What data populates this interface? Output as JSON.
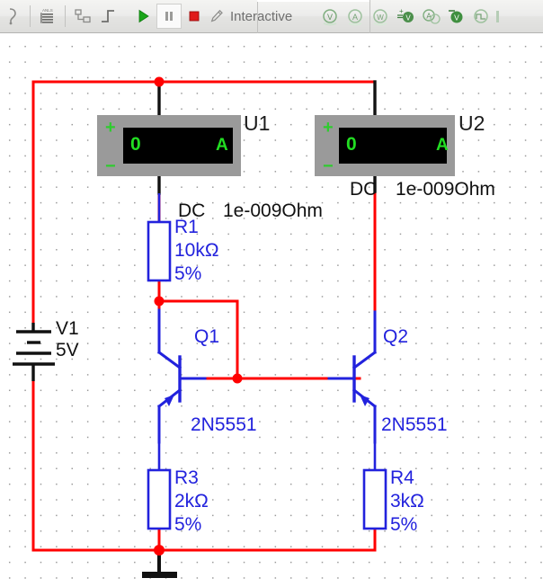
{
  "toolbar": {
    "left_icons": [
      {
        "name": "probe-tool-icon",
        "glyph": "⅃"
      },
      {
        "name": "analysis-list-icon",
        "glyph": "☰"
      },
      {
        "name": "postprocessor-icon",
        "glyph": "▫"
      },
      {
        "name": "step-signal-icon",
        "glyph": "┐"
      }
    ],
    "run_label": "",
    "pause_label": "",
    "stop_label": "",
    "mode_icon_name": "pencil-icon",
    "mode_label": "Interactive",
    "probe_icons": [
      {
        "name": "voltage-probe-icon",
        "glyph": "V"
      },
      {
        "name": "current-probe-icon",
        "glyph": "A"
      },
      {
        "name": "power-probe-icon",
        "glyph": "W"
      },
      {
        "name": "differential-voltage-probe-icon",
        "glyph": "V"
      },
      {
        "name": "differential-current-probe-icon",
        "glyph": "A"
      },
      {
        "name": "negative-voltage-probe-icon",
        "glyph": "V"
      },
      {
        "name": "waveform-probe-icon",
        "glyph": "⊓"
      }
    ]
  },
  "circuit": {
    "title": "current-mirror-schematic",
    "colors": {
      "wire_red": "#ff0000",
      "component_blue": "#2222dd",
      "wire_black": "#111111",
      "meter_body": "#9a9a9a",
      "meter_screen": "#000000",
      "display_green": "#22dd22"
    },
    "instruments": [
      {
        "ref": "U1",
        "kind": "ammeter",
        "display_value": "0",
        "display_unit": "A",
        "plus_terminal": "+",
        "minus_terminal": "−",
        "mode_label": "DC",
        "resistance_label": "1e-009Ohm"
      },
      {
        "ref": "U2",
        "kind": "ammeter",
        "display_value": "0",
        "display_unit": "A",
        "plus_terminal": "+",
        "minus_terminal": "−",
        "mode_label": "DC",
        "resistance_label": "1e-009Ohm"
      }
    ],
    "source": {
      "ref": "V1",
      "value": "5V"
    },
    "resistors": [
      {
        "ref": "R1",
        "value": "10kΩ",
        "tolerance": "5%"
      },
      {
        "ref": "R3",
        "value": "2kΩ",
        "tolerance": "5%"
      },
      {
        "ref": "R4",
        "value": "3kΩ",
        "tolerance": "5%"
      }
    ],
    "transistors": [
      {
        "ref": "Q1",
        "part": "2N5551"
      },
      {
        "ref": "Q2",
        "part": "2N5551"
      }
    ],
    "ground_label": ""
  }
}
